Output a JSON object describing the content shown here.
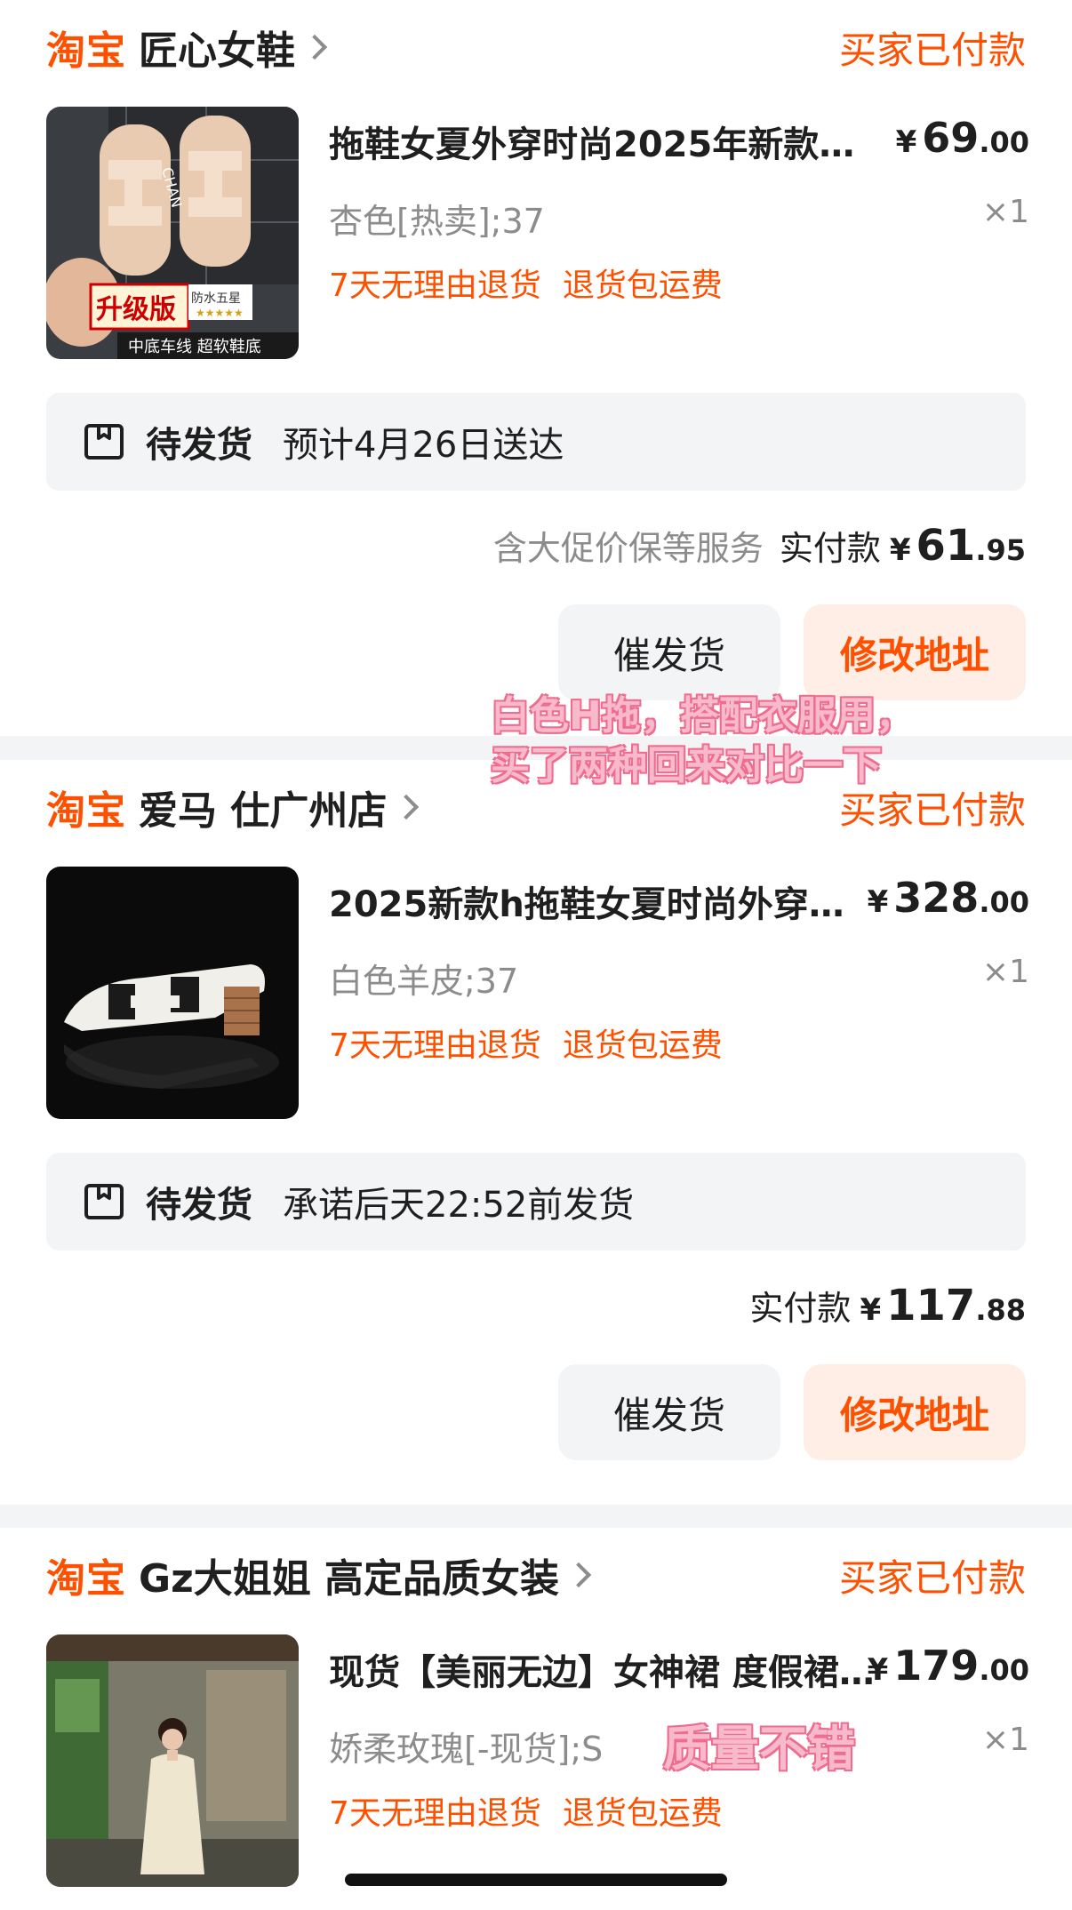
{
  "orders": [
    {
      "platform": "淘宝",
      "shop": "匠心女鞋",
      "status": "买家已付款",
      "title": "拖鞋女夏外穿时尚2025年新款…",
      "price": {
        "currency": "¥",
        "int": "69",
        "dec": ".00"
      },
      "sku": "杏色[热卖];37",
      "qty": "×1",
      "tags": [
        "7天无理由退货",
        "退货包运费"
      ],
      "ship_status": "待发货",
      "ship_eta": "预计4月26日送达",
      "services": "含大促价保等服务",
      "paid_label": "实付款",
      "paid": {
        "currency": "¥",
        "int": "61",
        "dec": ".95"
      },
      "btn_urge": "催发货",
      "btn_addr": "修改地址",
      "thumb": {
        "badge": "升级版",
        "badge2": "防水五星",
        "caption": "中底车线  超软鞋底",
        "brand_text": "CHAN"
      }
    },
    {
      "platform": "淘宝",
      "shop": "爱马 仕广州店",
      "status": "买家已付款",
      "title": "2025新款h拖鞋女夏时尚外穿…",
      "price": {
        "currency": "¥",
        "int": "328",
        "dec": ".00"
      },
      "sku": "白色羊皮;37",
      "qty": "×1",
      "tags": [
        "7天无理由退货",
        "退货包运费"
      ],
      "ship_status": "待发货",
      "ship_eta": "承诺后天22:52前发货",
      "services": "",
      "paid_label": "实付款",
      "paid": {
        "currency": "¥",
        "int": "117",
        "dec": ".88"
      },
      "btn_urge": "催发货",
      "btn_addr": "修改地址"
    },
    {
      "platform": "淘宝",
      "shop": "Gz大姐姐 高定品质女装",
      "status": "买家已付款",
      "title": "现货【美丽无边】女神裙 度假裙…",
      "price": {
        "currency": "¥",
        "int": "179",
        "dec": ".00"
      },
      "sku": "娇柔玫瑰[-现货];S",
      "qty": "×1",
      "tags": [
        "7天无理由退货",
        "退货包运费"
      ]
    }
  ],
  "annotations": {
    "note1_line1": "白色H拖，搭配衣服用，",
    "note1_line2": "买了两种回来对比一下",
    "note2": "质量不错"
  },
  "colors": {
    "accent": "#ff5000",
    "annotation": "#f7b9cc",
    "muted": "#8c8c8c"
  }
}
